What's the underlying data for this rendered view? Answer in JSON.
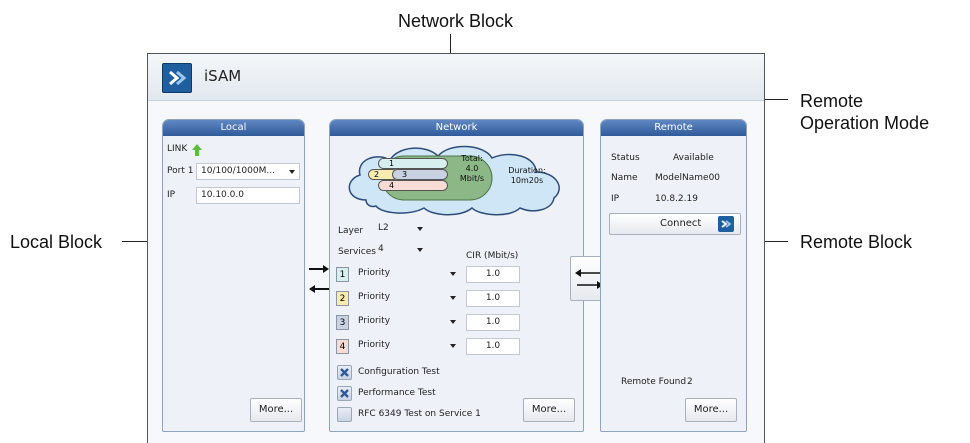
{
  "callouts": {
    "network_block": "Network Block",
    "remote_operation_mode_line1": "Remote",
    "remote_operation_mode_line2": "Operation Mode",
    "local_block": "Local Block",
    "remote_block": "Remote Block"
  },
  "app": {
    "title": "iSAM"
  },
  "local": {
    "header": "Local",
    "link_label": "LINK",
    "port_label": "Port 1",
    "port_value": "10/100/1000M...",
    "ip_label": "IP",
    "ip_value": "10.10.0.0",
    "more_label": "More..."
  },
  "network": {
    "header": "Network",
    "cloud": {
      "lane1": "1",
      "lane2": "2",
      "lane3": "3",
      "lane4": "4",
      "total_label": "Total:",
      "total_value": "4.0",
      "total_unit": "Mbit/s",
      "duration_label": "Duration:",
      "duration_value": "10m20s"
    },
    "layer_label": "Layer",
    "layer_value": "L2",
    "services_label": "Services",
    "services_value": "4",
    "cir_header": "CIR (Mbit/s)",
    "services": [
      {
        "num": "1",
        "mode": "Priority",
        "cir": "1.0"
      },
      {
        "num": "2",
        "mode": "Priority",
        "cir": "1.0"
      },
      {
        "num": "3",
        "mode": "Priority",
        "cir": "1.0"
      },
      {
        "num": "4",
        "mode": "Priority",
        "cir": "1.0"
      }
    ],
    "tests": {
      "configuration": "Configuration Test",
      "performance": "Performance Test",
      "rfc": "RFC 6349 Test on Service 1"
    },
    "more_label": "More..."
  },
  "remote": {
    "header": "Remote",
    "status_label": "Status",
    "status_value": "Available",
    "name_label": "Name",
    "name_value": "ModelName00",
    "ip_label": "IP",
    "ip_value": "10.8.2.19",
    "connect_label": "Connect",
    "found_label": "Remote Found",
    "found_value": "2",
    "more_label": "More..."
  },
  "colors": {
    "header_blue": "#2f5a99",
    "service1": "#d7f0ef",
    "service2": "#f7ebb0",
    "service3": "#c9d2e2",
    "service4": "#f6dcd5",
    "cloud_green": "#8bb886",
    "cloud_blue": "#cfe6f7"
  },
  "icons": [
    "isam-logo-icon",
    "link-up-arrow-icon",
    "dropdown-arrow-icon",
    "remote-mode-arrows-icon",
    "x-icon",
    "connect-logo-icon"
  ]
}
